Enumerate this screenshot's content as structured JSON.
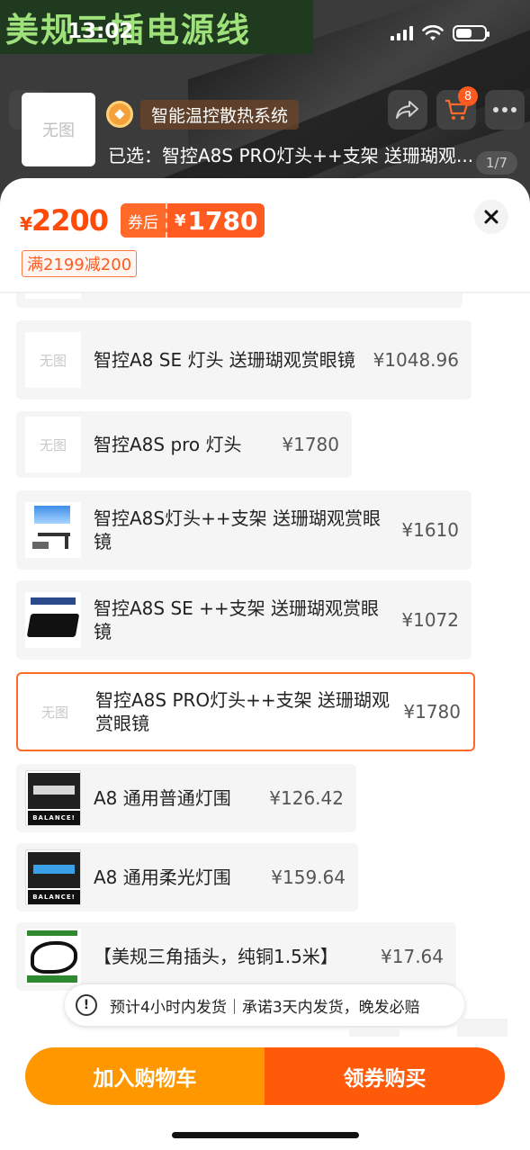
{
  "status_bar": {
    "time": "13:02"
  },
  "banner": {
    "text": "美规三插电源线"
  },
  "header": {
    "feature_badge": "智能温控散热系统",
    "selected": "已选：智控A8S PRO灯头++支架 送珊瑚观...",
    "image_counter": "1/7",
    "cart_count": "8",
    "thumb_placeholder": "无图"
  },
  "pricing": {
    "currency": "¥",
    "original": "2200",
    "coupon_label": "券后",
    "after_coupon": "1780",
    "discount": "满2199减200"
  },
  "options": [
    {
      "name": "智控A8 SE 灯头 送珊瑚观赏眼镜",
      "price": "¥1048.96",
      "thumb": "无图",
      "selected": false
    },
    {
      "name": "智控A8S  pro 灯头",
      "price": "¥1780",
      "thumb": "无图",
      "selected": false
    },
    {
      "name": "智控A8S灯头++支架 送珊瑚观赏眼镜",
      "price": "¥1610",
      "thumb": "",
      "selected": false
    },
    {
      "name": "智控A8S  SE ++支架 送珊瑚观赏眼镜",
      "price": "¥1072",
      "thumb": "",
      "selected": false
    },
    {
      "name": "智控A8S PRO灯头++支架 送珊瑚观赏眼镜",
      "price": "¥1780",
      "thumb": "无图",
      "selected": true
    },
    {
      "name": "A8 通用普通灯围",
      "price": "¥126.42",
      "thumb": "BALANCE!",
      "selected": false
    },
    {
      "name": "A8 通用柔光灯围",
      "price": "¥159.64",
      "thumb": "BALANCE!",
      "selected": false
    },
    {
      "name": "【美规三角插头，纯铜1.5米】",
      "price": "¥17.64",
      "thumb": "",
      "selected": false
    }
  ],
  "shipping_note": "预计4小时内发货｜承诺3天内发货，晚发必赔",
  "actions": {
    "add_to_cart": "加入购物车",
    "buy": "领券购买"
  },
  "colors": {
    "accent": "#ff5a1f",
    "add_cart": "#ff9800",
    "buy": "#ff5a0a"
  }
}
